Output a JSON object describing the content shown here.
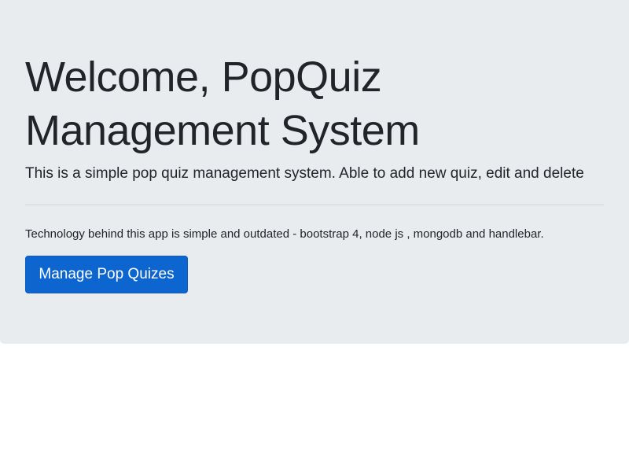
{
  "jumbotron": {
    "title": "Welcome, PopQuiz Management System",
    "lead": "This is a simple pop quiz management system. Able to add new quiz, edit and delete",
    "tech_text": "Technology behind this app is simple and outdated - bootstrap 4, node js , mongodb and handlebar.",
    "button_label": "Manage Pop Quizes"
  },
  "colors": {
    "jumbotron_background": "#e9ecef",
    "primary_button": "#0d66d0",
    "text": "#212529"
  }
}
